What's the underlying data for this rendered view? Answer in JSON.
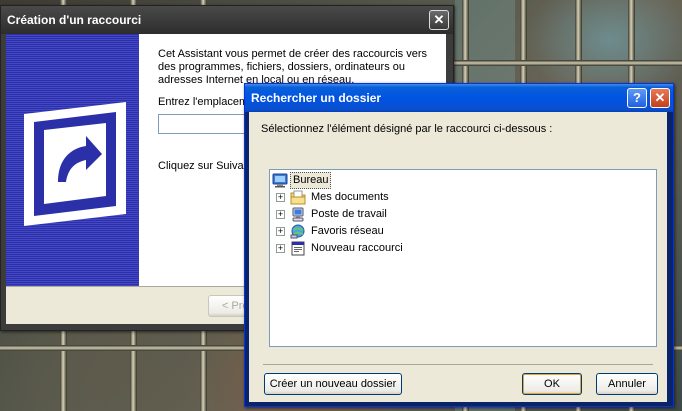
{
  "wizard": {
    "title": "Création d'un raccourci",
    "close_glyph": "✕",
    "description": "Cet Assistant vous permet de créer des raccourcis vers des programmes, fichiers, dossiers, ordinateurs ou adresses Internet en local ou en réseau.",
    "location_label": "Entrez l'emplacement",
    "location_value": "",
    "next_hint": "Cliquez sur Suivant",
    "back_button": "< Préc"
  },
  "browse": {
    "title": "Rechercher un dossier",
    "help_glyph": "?",
    "close_glyph": "✕",
    "prompt": "Sélectionnez l'élément désigné par le raccourci ci-dessous :",
    "tree": {
      "root": {
        "label": "Bureau",
        "icon": "desktop-icon"
      },
      "children": [
        {
          "label": "Mes documents",
          "icon": "folder-documents-icon",
          "expand": "+"
        },
        {
          "label": "Poste de travail",
          "icon": "computer-icon",
          "expand": "+"
        },
        {
          "label": "Favoris réseau",
          "icon": "network-icon",
          "expand": "+"
        },
        {
          "label": "Nouveau raccourci",
          "icon": "shortcut-file-icon",
          "expand": "+"
        }
      ]
    },
    "new_folder_button": "Créer un nouveau dossier",
    "ok_button": "OK",
    "cancel_button": "Annuler"
  },
  "colors": {
    "xp_title_blue": "#0054e3",
    "banner_blue": "#2b2fa8",
    "close_red": "#c2401c"
  }
}
